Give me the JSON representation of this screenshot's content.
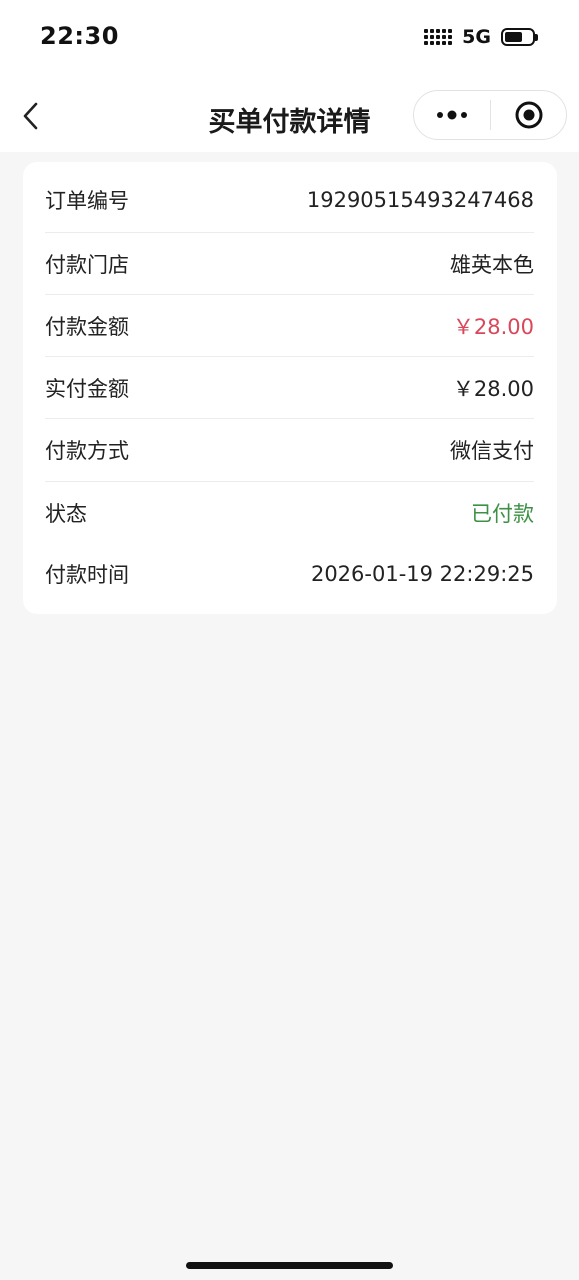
{
  "status_bar": {
    "time": "22:30",
    "network": "5G"
  },
  "nav": {
    "title": "买单付款详情"
  },
  "details": [
    {
      "label": "订单编号",
      "value": "19290515493247468",
      "tone": "normal"
    },
    {
      "label": "付款门店",
      "value": "雄英本色",
      "tone": "normal"
    },
    {
      "label": "付款金额",
      "value": "￥28.00",
      "tone": "red"
    },
    {
      "label": "实付金额",
      "value": "￥28.00",
      "tone": "normal"
    },
    {
      "label": "付款方式",
      "value": "微信支付",
      "tone": "normal"
    },
    {
      "label": "状态",
      "value": "已付款",
      "tone": "green"
    },
    {
      "label": "付款时间",
      "value": "2026-01-19 22:29:25",
      "tone": "normal"
    }
  ],
  "colors": {
    "accent_red": "#d9475a",
    "accent_green": "#3c9144",
    "background": "#f6f6f6"
  }
}
